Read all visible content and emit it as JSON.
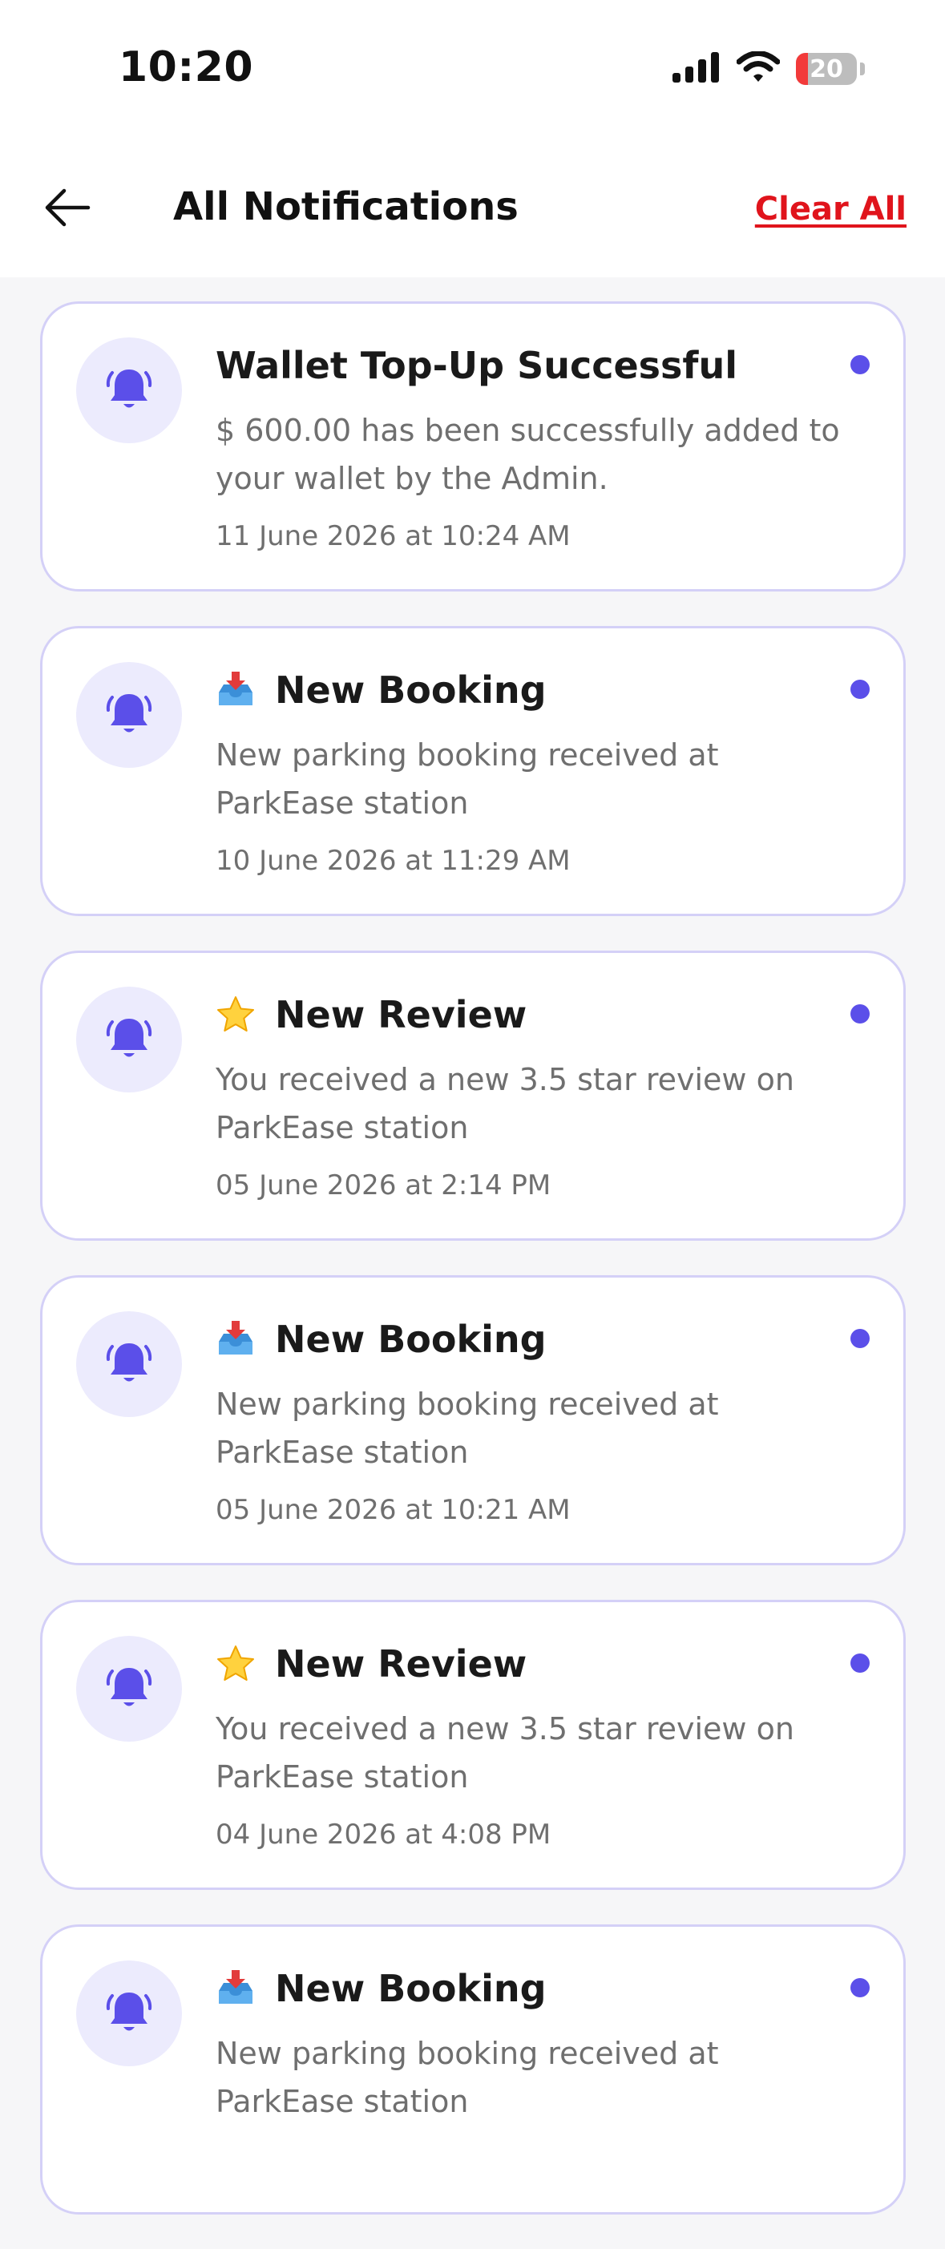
{
  "status_bar": {
    "time": "10:20",
    "battery_level": "20",
    "battery_fraction": 0.2,
    "icons": [
      "signal-icon",
      "wifi-icon",
      "battery-icon"
    ]
  },
  "header": {
    "back_icon": "arrow-left-icon",
    "title": "All Notifications",
    "clear_all_label": "Clear All"
  },
  "colors": {
    "accent": "#5b4fe9",
    "bell_bg": "#ecebfd",
    "card_border": "#d4d0f7",
    "danger": "#e0141c"
  },
  "notifications": [
    {
      "icon": "bell-icon",
      "emoji": "",
      "title": "Wallet Top-Up Successful",
      "message": "$ 600.00 has been successfully added to your wallet by the Admin.",
      "time": "11 June 2026 at 10:24 AM",
      "unread": true
    },
    {
      "icon": "bell-icon",
      "emoji": "inbox-tray-icon",
      "title": "New Booking",
      "message": "New parking booking received at ParkEase station",
      "time": "10 June 2026 at 11:29 AM",
      "unread": true
    },
    {
      "icon": "bell-icon",
      "emoji": "star-icon",
      "title": "New Review",
      "message": "You received a new 3.5 star review on ParkEase station",
      "time": "05 June 2026 at 2:14 PM",
      "unread": true
    },
    {
      "icon": "bell-icon",
      "emoji": "inbox-tray-icon",
      "title": "New Booking",
      "message": "New parking booking received at ParkEase station",
      "time": "05 June 2026 at 10:21 AM",
      "unread": true
    },
    {
      "icon": "bell-icon",
      "emoji": "star-icon",
      "title": "New Review",
      "message": "You received a new 3.5 star review on ParkEase station",
      "time": "04 June 2026 at 4:08 PM",
      "unread": true
    },
    {
      "icon": "bell-icon",
      "emoji": "inbox-tray-icon",
      "title": "New Booking",
      "message": "New parking booking received at ParkEase station",
      "time": "",
      "unread": true
    }
  ]
}
